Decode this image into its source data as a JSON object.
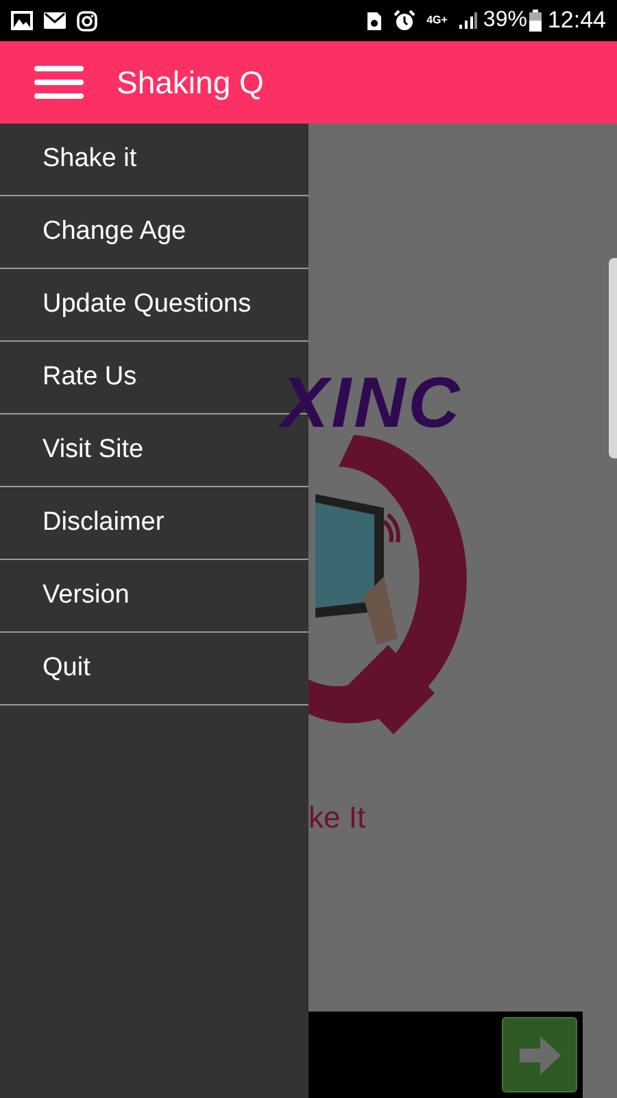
{
  "status_bar": {
    "network": "4G+",
    "battery": "39%",
    "time": "12:44"
  },
  "app_bar": {
    "title": "Shaking Q"
  },
  "drawer": {
    "items": [
      {
        "label": "Shake it"
      },
      {
        "label": "Change Age"
      },
      {
        "label": "Update Questions"
      },
      {
        "label": "Rate Us"
      },
      {
        "label": "Visit Site"
      },
      {
        "label": "Disclaimer"
      },
      {
        "label": "Version"
      },
      {
        "label": "Quit"
      }
    ]
  },
  "content": {
    "logo_text": "XINC",
    "caption": "ke It"
  }
}
